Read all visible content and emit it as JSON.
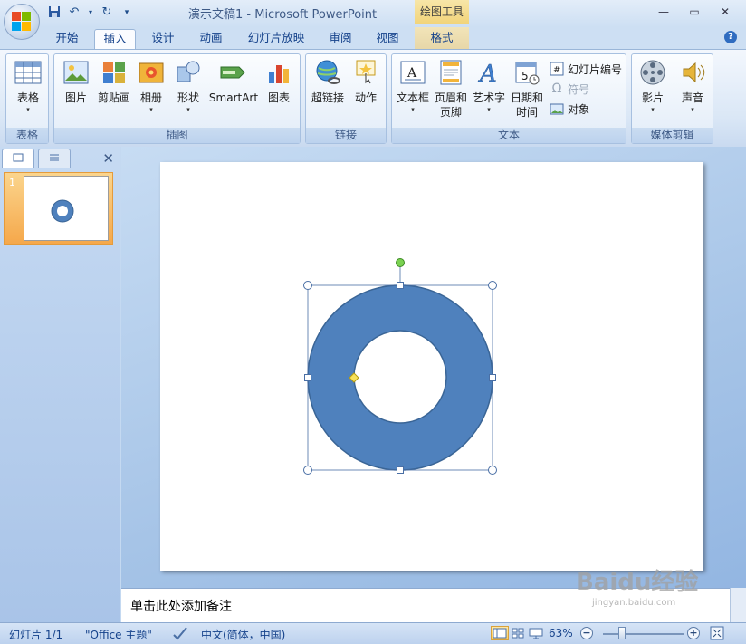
{
  "titlebar": {
    "title": "演示文稿1 - Microsoft PowerPoint",
    "context_tool": "绘图工具"
  },
  "tabs": [
    {
      "label": "开始"
    },
    {
      "label": "插入",
      "active": true
    },
    {
      "label": "设计"
    },
    {
      "label": "动画"
    },
    {
      "label": "幻灯片放映"
    },
    {
      "label": "审阅"
    },
    {
      "label": "视图"
    },
    {
      "label": "格式",
      "contextual": true
    }
  ],
  "ribbon": {
    "groups": {
      "table": {
        "label": "表格",
        "buttons": [
          "表格"
        ]
      },
      "illustrations": {
        "label": "插图",
        "buttons": [
          "图片",
          "剪贴画",
          "相册",
          "形状",
          "SmartArt",
          "图表"
        ]
      },
      "links": {
        "label": "链接",
        "buttons": [
          "超链接",
          "动作"
        ]
      },
      "text": {
        "label": "文本",
        "buttons": [
          "文本框",
          "页眉和",
          "页脚",
          "艺术字",
          "日期和",
          "时间"
        ],
        "small": [
          "幻灯片编号",
          "符号",
          "对象"
        ]
      },
      "media": {
        "label": "媒体剪辑",
        "buttons": [
          "影片",
          "声音"
        ]
      }
    }
  },
  "slides_panel": {
    "thumb_number": "1"
  },
  "notes": {
    "placeholder": "单击此处添加备注"
  },
  "statusbar": {
    "slide_info": "幻灯片 1/1",
    "theme": "\"Office 主题\"",
    "language": "中文(简体，中国)",
    "zoom": "63%"
  },
  "watermark": {
    "text": "Baidu经验",
    "sub": "jingyan.baidu.com"
  },
  "colors": {
    "shape_fill": "#4f81bd",
    "shape_stroke": "#3a6596"
  }
}
